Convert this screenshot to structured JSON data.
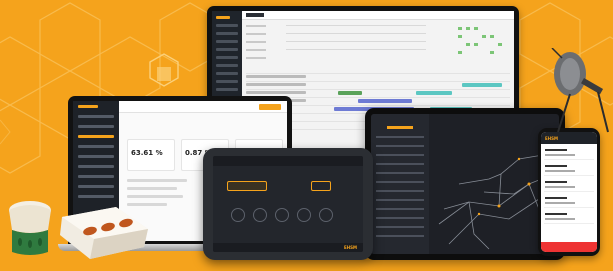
{
  "colors": {
    "background": "#f5a31c",
    "hex_line": "#f9c25a",
    "accent": "#f5a31c",
    "dark_ui": "#1e2228"
  },
  "laptop": {
    "kpi_values": [
      "63.61 %",
      "0.87 %"
    ]
  },
  "rugged_phone": {
    "logo": "EHSM"
  },
  "smartphone": {
    "brand": "EHSM"
  },
  "devices": {
    "green_beacon_icon": "cylindrical-beacon-icon",
    "white_tag_icon": "wearable-tag-icon",
    "sensor_icon": "antenna-sensor-icon"
  }
}
